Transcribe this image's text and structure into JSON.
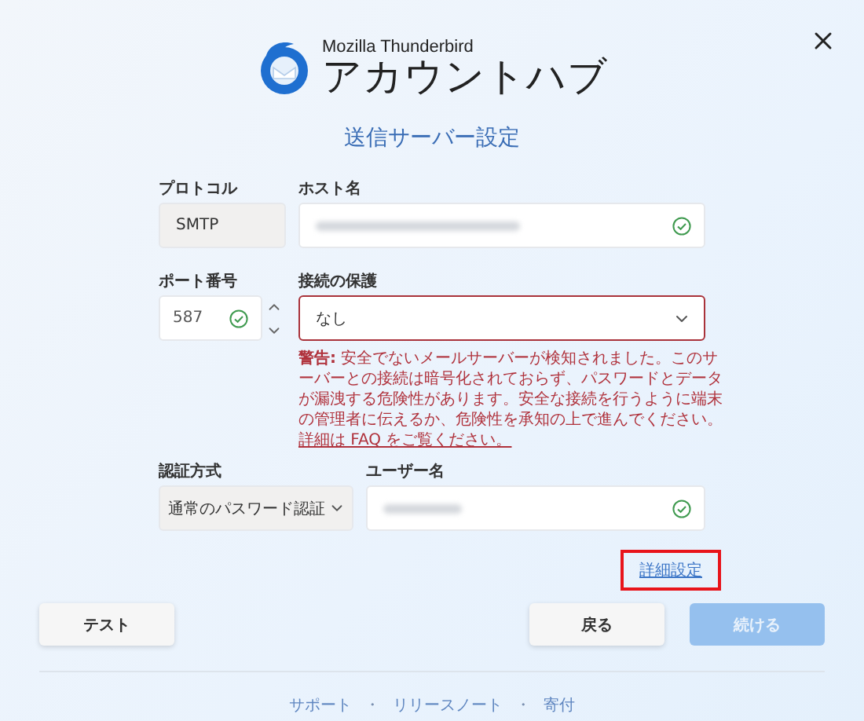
{
  "brand": {
    "product": "Mozilla Thunderbird",
    "title": "アカウントハブ"
  },
  "heading": "送信サーバー設定",
  "protocol": {
    "label": "プロトコル",
    "value": "SMTP",
    "disabled": true
  },
  "host": {
    "label": "ホスト名",
    "valid": true,
    "blurred": true
  },
  "port": {
    "label": "ポート番号",
    "value": "587",
    "valid": true
  },
  "security": {
    "label": "接続の保護",
    "value": "なし",
    "error": true
  },
  "warning": {
    "text": "**警告:** 安全でないメールサーバーが検知されました。このサーバーとの接続は暗号化されておらず、パスワードとデータが漏洩する危険性があります。安全な接続を行うように端末の管理者に伝えるか、危険性を承知の上で進んでください。",
    "link": "詳細は FAQ をご覧ください。"
  },
  "auth": {
    "label": "認証方式",
    "value": "通常のパスワード認証"
  },
  "username": {
    "label": "ユーザー名",
    "valid": true,
    "blurred": true
  },
  "advanced_link": {
    "label": "詳細設定",
    "highlighted": true
  },
  "buttons": [
    {
      "label": "テスト",
      "kind": "secondary",
      "disabled": false
    },
    {
      "label": "戻る",
      "kind": "secondary",
      "disabled": false
    },
    {
      "label": "続ける",
      "kind": "primary",
      "disabled": true
    }
  ],
  "footer_links": [
    "サポート",
    "リリースノート",
    "寄付"
  ],
  "footer_separators": [
    "・",
    "・"
  ]
}
